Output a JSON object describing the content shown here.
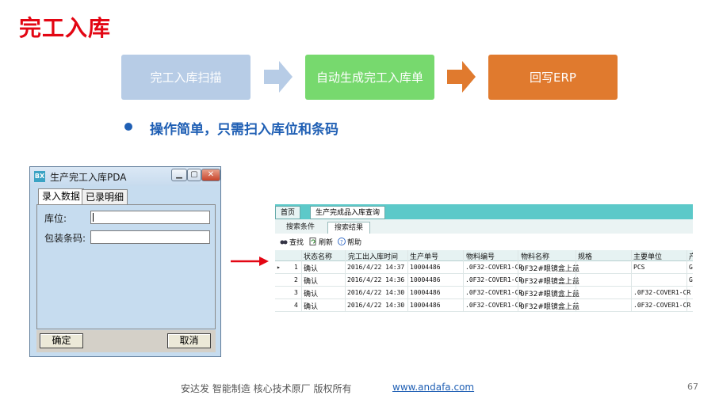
{
  "slide": {
    "title": "完工入库",
    "bullet": "操作简单，只需扫入库位和条码",
    "footer": "安达发   智能制造 核心技术原厂    版权所有",
    "footer_link": "www.andafa.com",
    "page_number": "67"
  },
  "flow": {
    "steps": [
      "完工入库扫描",
      "自动生成完工入库单",
      "回写ERP"
    ],
    "colors": [
      "#b7cce6",
      "#77d96e",
      "#e07a2e"
    ]
  },
  "pda": {
    "app_icon": "BX",
    "title": "生产完工入库PDA",
    "tabs": [
      "录入数据",
      "已录明细"
    ],
    "location_label": "库位:",
    "location_value": "",
    "barcode_label": "包装条码:",
    "barcode_value": "",
    "confirm_label": "确定",
    "cancel_label": "取消"
  },
  "grid": {
    "tabs": [
      "首页",
      "生产完成品入库查询"
    ],
    "subtabs": [
      "搜索条件",
      "搜索结果"
    ],
    "toolbar": [
      "查找",
      "刷新",
      "帮助"
    ],
    "headers": [
      "状态名称",
      "完工出入库时间",
      "生产单号",
      "物料编号",
      "物料名称",
      "规格",
      "主要单位",
      "产"
    ],
    "rows": [
      {
        "no": "1",
        "status": "确认",
        "time": "2016/4/22 14:37",
        "order": "10004486",
        "code": ".0F32-COVER1-CR",
        "name": "0F32#眼镜盒上盖",
        "spec": "",
        "unit": "PCS",
        "extra": "G"
      },
      {
        "no": "2",
        "status": "确认",
        "time": "2016/4/22 14:36",
        "order": "10004486",
        "code": ".0F32-COVER1-CR",
        "name": "0F32#眼镜盒上盖",
        "spec": "",
        "unit": "",
        "extra": "G"
      },
      {
        "no": "3",
        "status": "确认",
        "time": "2016/4/22 14:30",
        "order": "10004486",
        "code": ".0F32-COVER1-CR",
        "name": "0F32#眼镜盒上盖",
        "spec": "",
        "unit": ".0F32-COVER1-CR",
        "extra": ""
      },
      {
        "no": "4",
        "status": "确认",
        "time": "2016/4/22 14:30",
        "order": "10004486",
        "code": ".0F32-COVER1-CR",
        "name": "0F32#眼镜盒上盖",
        "spec": "",
        "unit": ".0F32-COVER1-CR",
        "extra": ""
      }
    ]
  },
  "colors": {
    "title_red": "#e30613",
    "accent_blue": "#1f5fb4",
    "arrow_red": "#e30613"
  }
}
